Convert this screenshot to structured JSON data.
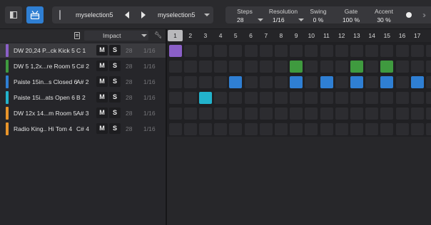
{
  "toolbar": {
    "selection_left": "myselection5",
    "selection_right": "myselection5",
    "params": [
      {
        "label": "Steps",
        "value": "28"
      },
      {
        "label": "Resolution",
        "value": "1/16"
      },
      {
        "label": "Swing",
        "value": "0 %"
      },
      {
        "label": "Gate",
        "value": "100 %"
      },
      {
        "label": "Accent",
        "value": "30 %"
      }
    ],
    "accent_color": "#2f7fd3"
  },
  "tracks_header": {
    "kit_name": "Impact"
  },
  "tracks": [
    {
      "name": "DW 20,24 P...ck Kick 5",
      "note": "C 1",
      "mute": "M",
      "solo": "S",
      "steps": "28",
      "resolution": "1/16",
      "color": "#8a5fc7",
      "selected": true
    },
    {
      "name": "DW 5 1,2x...re Room 5",
      "note": "C# 2",
      "mute": "M",
      "solo": "S",
      "steps": "28",
      "resolution": "1/16",
      "color": "#3f9a3f",
      "selected": false
    },
    {
      "name": "Paiste 15in...s Closed 6",
      "note": "A# 2",
      "mute": "M",
      "solo": "S",
      "steps": "28",
      "resolution": "1/16",
      "color": "#2f7fd3",
      "selected": false
    },
    {
      "name": "Paiste 15i...ats Open 6",
      "note": "B 2",
      "mute": "M",
      "solo": "S",
      "steps": "28",
      "resolution": "1/16",
      "color": "#22b3cc",
      "selected": false
    },
    {
      "name": "DW 12x 14...m Room 5",
      "note": "A# 3",
      "mute": "M",
      "solo": "S",
      "steps": "28",
      "resolution": "1/16",
      "color": "#e8942a",
      "selected": false
    },
    {
      "name": "Radio King.. Hi Tom 4",
      "note": "C# 4",
      "mute": "M",
      "solo": "S",
      "steps": "28",
      "resolution": "1/16",
      "color": "#e8942a",
      "selected": false
    }
  ],
  "step_numbers": [
    "1",
    "2",
    "3",
    "4",
    "5",
    "6",
    "7",
    "8",
    "9",
    "10",
    "11",
    "12",
    "13",
    "14",
    "15",
    "16",
    "17",
    "1"
  ],
  "active_step": 1,
  "pattern": [
    {
      "color": "#8a5fc7",
      "steps": [
        1
      ]
    },
    {
      "color": "#3f9a3f",
      "steps": [
        9,
        13,
        15
      ]
    },
    {
      "color": "#2f7fd3",
      "steps": [
        5,
        9,
        11,
        13,
        15,
        17
      ]
    },
    {
      "color": "#22b3cc",
      "steps": [
        3
      ]
    },
    {
      "color": "#e8942a",
      "steps": []
    },
    {
      "color": "#e8942a",
      "steps": []
    }
  ]
}
